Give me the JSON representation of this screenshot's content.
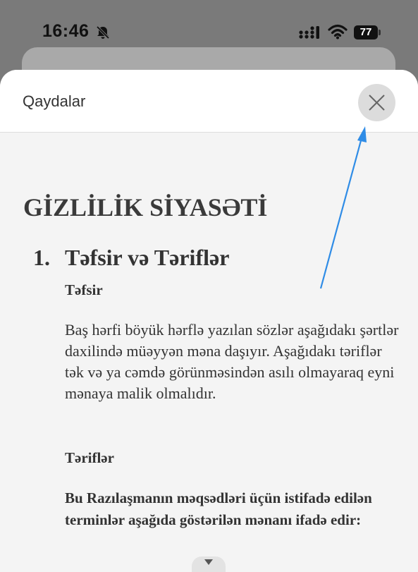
{
  "status_bar": {
    "time": "16:46",
    "battery": "77",
    "icons": [
      "bell-off-icon",
      "signal-icon",
      "wifi-icon",
      "battery-icon"
    ]
  },
  "sheet": {
    "title": "Qaydalar",
    "close_icon": "close-icon"
  },
  "document": {
    "title": "GİZLİLİK SİYASƏTİ",
    "section_number": "1.",
    "section_title": "Təfsir və Təriflər",
    "subheading_1": "Təfsir",
    "paragraph_1": "Baş hərfi böyük hərflə yazılan sözlər aşağıdakı şərtlər daxilində müəyyən məna daşıyır. Aşağıdakı təriflər tək və ya cəmdə görünməsindən asılı olmayaraq eyni mənaya malik olmalıdır.",
    "subheading_2": "Təriflər",
    "paragraph_2": "Bu Razılaşmanın məqsədləri üçün istifadə edilən terminlər aşağıda göstərilən mənanı ifadə edir:"
  },
  "annotation": {
    "arrow_color": "#2F8CE6"
  },
  "colors": {
    "sheet_background": "#F4F4F4",
    "header_background": "#FFFFFF",
    "close_button_background": "#DCDCDC"
  }
}
